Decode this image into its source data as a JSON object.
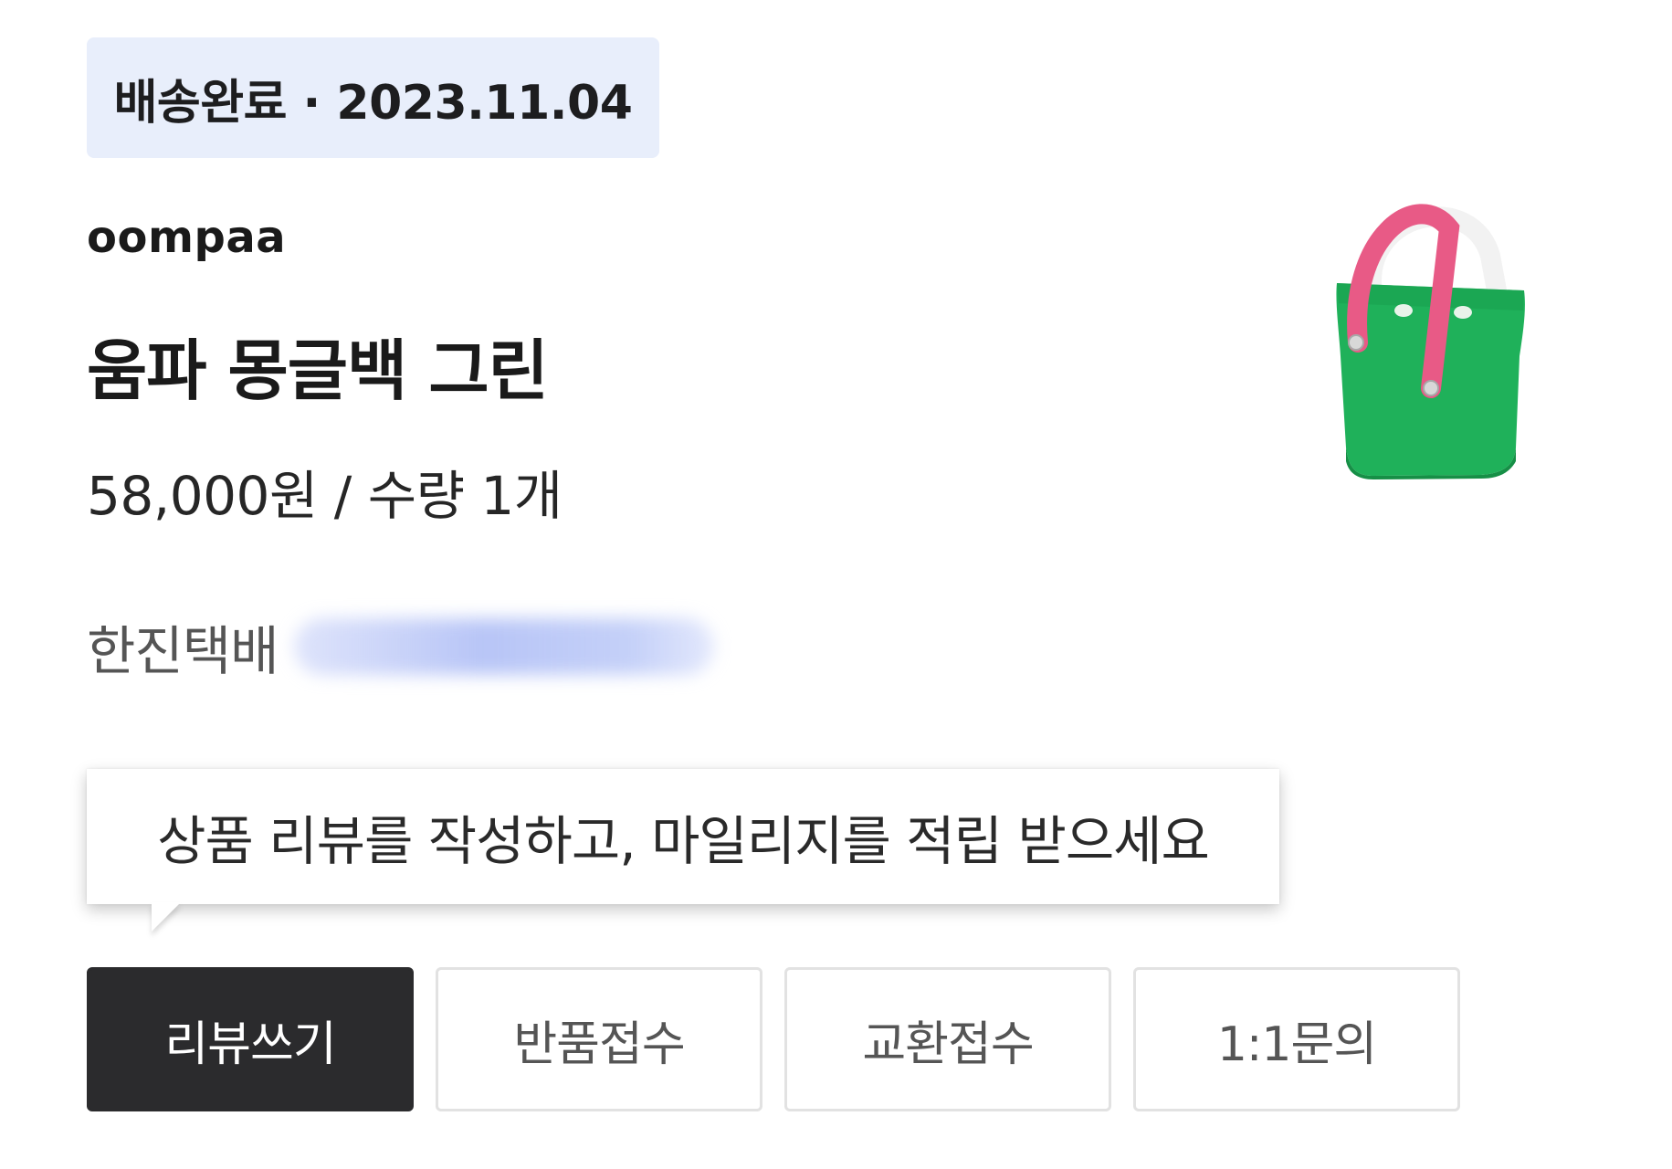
{
  "order": {
    "status_text": "배송완료 · 2023.11.04",
    "brand": "oompaa",
    "product_name": "움파 몽글백 그린",
    "price_quantity": "58,000원 / 수량 1개",
    "carrier": "한진택배",
    "tracking_number": "",
    "image_icon": "green-tote-bag-with-pink-handle"
  },
  "review_tooltip": {
    "text": "상품 리뷰를 작성하고, 마일리지를 적립 받으세요"
  },
  "actions": {
    "write_review": "리뷰쓰기",
    "return_request": "반품접수",
    "exchange_request": "교환접수",
    "inquiry": "1:1문의"
  },
  "colors": {
    "status_badge_bg": "#e8eefb",
    "primary_button_bg": "#2b2b2d",
    "bag_green": "#1fb15a",
    "handle_pink": "#e85a86"
  }
}
